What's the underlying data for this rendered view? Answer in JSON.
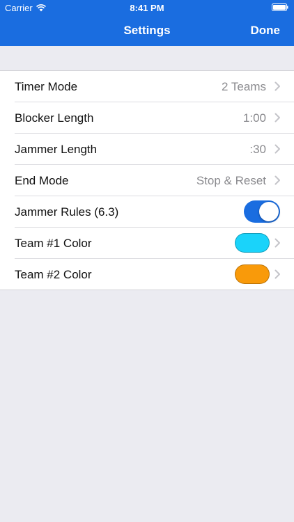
{
  "status_bar": {
    "carrier": "Carrier",
    "time": "8:41 PM",
    "wifi_icon": "wifi-icon",
    "battery_icon": "battery-icon"
  },
  "nav": {
    "title": "Settings",
    "done_label": "Done",
    "color": "#1a6de0"
  },
  "settings": {
    "timer_mode": {
      "label": "Timer Mode",
      "value": "2 Teams"
    },
    "blocker_length": {
      "label": "Blocker Length",
      "value": "1:00"
    },
    "jammer_length": {
      "label": "Jammer Length",
      "value": ":30"
    },
    "end_mode": {
      "label": "End Mode",
      "value": "Stop & Reset"
    },
    "jammer_rules": {
      "label": "Jammer Rules (6.3)",
      "enabled": true
    },
    "team1_color": {
      "label": "Team #1 Color",
      "color": "#1ad3fa"
    },
    "team2_color": {
      "label": "Team #2 Color",
      "color": "#f99a0a"
    }
  }
}
